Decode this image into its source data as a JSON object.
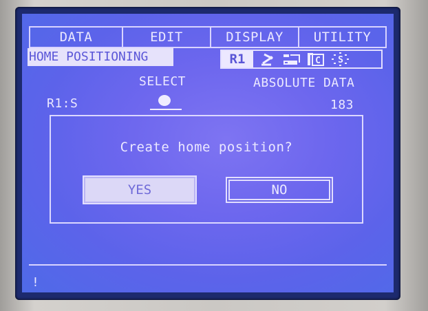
{
  "menu": {
    "items": [
      {
        "label": "DATA"
      },
      {
        "label": "EDIT"
      },
      {
        "label": "DISPLAY"
      },
      {
        "label": "UTILITY"
      }
    ]
  },
  "header": {
    "title": "HOME POSITIONING"
  },
  "status": {
    "robot": "R1",
    "icons": [
      "robot-arm-icon",
      "teach-mode-icon",
      "coordinate-mode-icon",
      "servo-status-icon"
    ],
    "coord_letter": "C",
    "servo_letter": "S"
  },
  "axis": {
    "select_label": "SELECT",
    "absolute_label": "ABSOLUTE DATA",
    "name": "R1:S",
    "absolute_value": "183"
  },
  "dialog": {
    "message": "Create home position?",
    "yes_label": "YES",
    "no_label": "NO",
    "focused": "NO"
  },
  "footer": {
    "cursor": "!"
  },
  "colors": {
    "lcd_background": "#6d67ee",
    "lcd_text": "#ebe8ff",
    "highlight_text": "#5b57d8",
    "bezel": "#cbc8c4"
  }
}
